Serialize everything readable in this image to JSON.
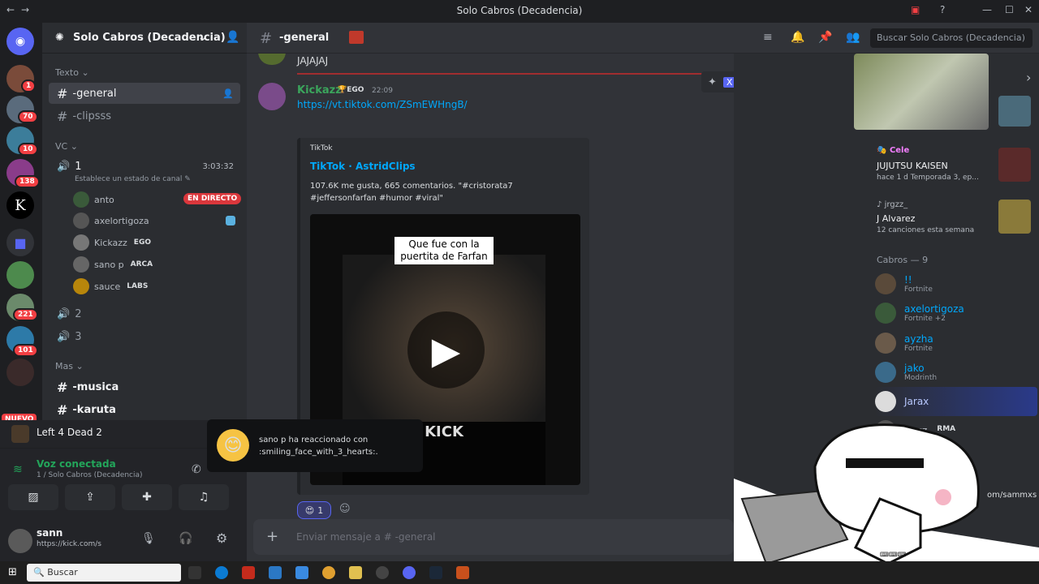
{
  "titlebar": {
    "title": "Solo Cabros (Decadencia)"
  },
  "server": {
    "name": "Solo Cabros (Decadencia)",
    "badges": [
      "1",
      "70",
      "10",
      "138",
      "221",
      "101"
    ],
    "new_label": "NUEVO"
  },
  "channels": {
    "text_cat": "Texto",
    "general": "-general",
    "clips": "-clipsss",
    "vc_cat": "VC",
    "voice1": "1",
    "voice1_time": "3:03:32",
    "voice_status": "Establece un estado de canal",
    "voice_users": [
      {
        "name": "anto",
        "tag": ""
      },
      {
        "name": "axelortigoza",
        "tag": ""
      },
      {
        "name": "Kickazz",
        "tag": "EGO"
      },
      {
        "name": "sano p",
        "tag": "ARCA"
      },
      {
        "name": "sauce",
        "tag": "LABS"
      }
    ],
    "live": "EN DIRECTO",
    "voice2": "2",
    "voice3": "3",
    "mas_cat": "Mas",
    "musica": "-musica",
    "karuta": "-karuta"
  },
  "activity": {
    "game": "Left 4 Dead 2"
  },
  "voice": {
    "connected": "Voz conectada",
    "sub": "1 / Solo Cabros (Decadencia)"
  },
  "user": {
    "name": "sann",
    "status": "https://kick.com/s"
  },
  "header": {
    "channel": "-general",
    "search_placeholder": "Buscar Solo Cabros (Decadencia)"
  },
  "messages": {
    "prev_text": "JAJAJAJ",
    "author": "Kickazz",
    "author_tag": "EGO",
    "time": "22:09",
    "link": "https://vt.tiktok.com/ZSmEWHngB/",
    "embed_provider": "TikTok",
    "embed_title": "TikTok · AstridClips",
    "embed_desc": "107.6K me gusta, 665 comentarios. \"#cristorata7 #jeffersonfarfan #humor #viral\"",
    "video_caption": "Que fue con la puertita de Farfan",
    "video_watermark": "KICK",
    "reaction_count": "1"
  },
  "composer": {
    "placeholder": "Enviar mensaje a #  -general"
  },
  "toast": {
    "text": "sano p ha reaccionado con :smiling_face_with_3_hearts:."
  },
  "activity_panel": {
    "card1_user": "Cele",
    "card1_title": "JUJUTSU KAISEN",
    "card1_sub": "hace 1 d  Temporada 3, ep...",
    "card2_user": "jrgzz_",
    "card2_title": "J Alvarez",
    "card2_sub": "12 canciones esta semana"
  },
  "members": {
    "header": "Cabros — 9",
    "list": [
      {
        "name": "!!",
        "sub": "Fortnite"
      },
      {
        "name": "axelortigoza",
        "sub": "Fortnite +2"
      },
      {
        "name": "ayzha",
        "sub": "Fortnite"
      },
      {
        "name": "jako",
        "sub": "Modrinth"
      },
      {
        "name": "Jarax",
        "sub": ""
      },
      {
        "name": "jrgzz_",
        "sub": "RMA"
      }
    ],
    "overlay_text": "om/sammxs"
  },
  "taskbar": {
    "search": "Buscar"
  }
}
